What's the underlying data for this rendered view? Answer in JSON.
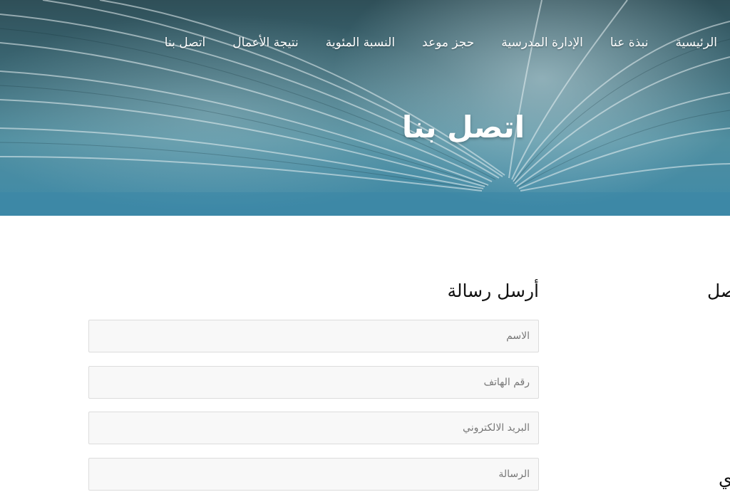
{
  "nav": {
    "items": [
      {
        "label": "الرئيسية"
      },
      {
        "label": "نبذة عنا"
      },
      {
        "label": "الإدارة المدرسية"
      },
      {
        "label": "حجز موعد"
      },
      {
        "label": "النسبة المئوية"
      },
      {
        "label": "نتيجة الأعمال"
      },
      {
        "label": "اتصل بنا"
      }
    ]
  },
  "hero": {
    "title": "اتصل بنا"
  },
  "form": {
    "heading": "أرسل رسالة",
    "name_placeholder": "الاسم",
    "phone_placeholder": "رقم الهاتف",
    "email_placeholder": "البريد الالكتروني",
    "message_placeholder": "الرسالة"
  },
  "sidebar": {
    "heading_fragment": "اتصل",
    "second_heading_fragment": "ي"
  },
  "colors": {
    "hero_teal": "#3f8aa8",
    "hero_dark": "#2f4f58",
    "field_bg": "#f8f8f8",
    "field_border": "#dcdcdc"
  }
}
